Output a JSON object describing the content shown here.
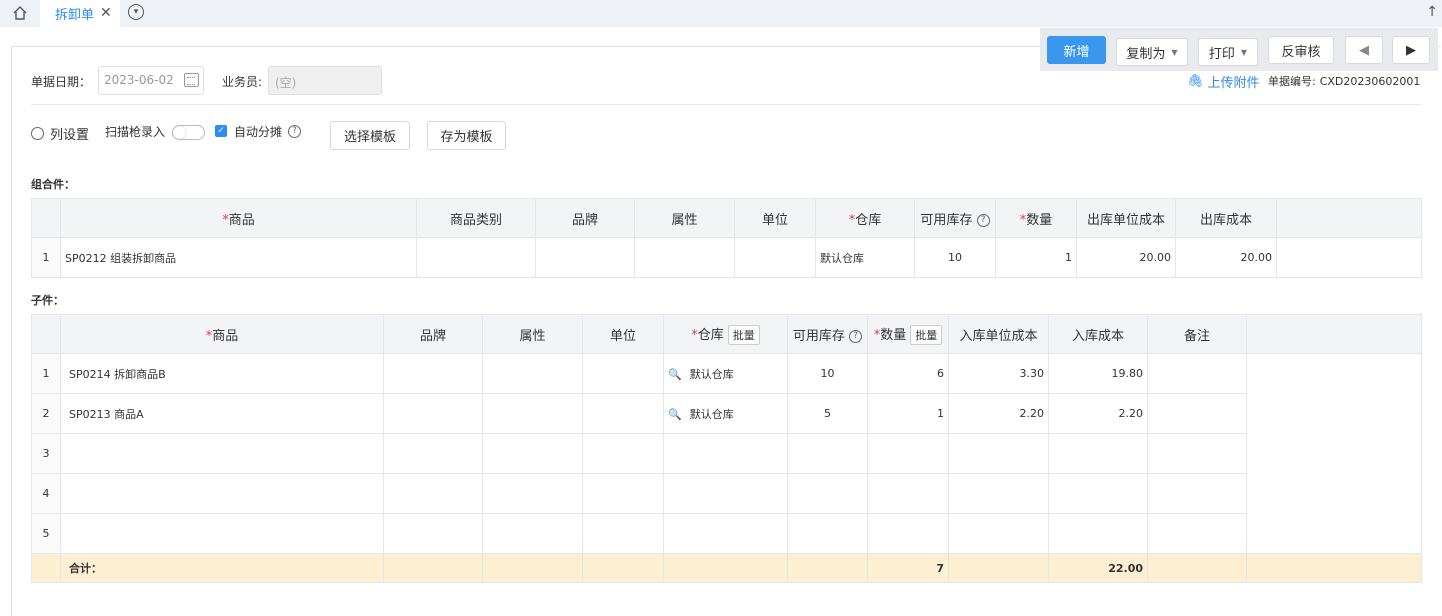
{
  "tabs": {
    "active": "拆卸单"
  },
  "toolbar": {
    "add": "新增",
    "copy_as": "复制为",
    "print": "打印",
    "unaudit": "反审核"
  },
  "header": {
    "date_label": "单据日期：",
    "date_value": "2023-06-02",
    "salesperson_label": "业务员:",
    "salesperson_value": "(空)",
    "upload": "上传附件",
    "doc_no_label": "单据编号:",
    "doc_no": "CXD20230602001"
  },
  "options": {
    "columns": "列设置",
    "scan": "扫描枪录入",
    "auto_alloc": "自动分摊",
    "choose_template": "选择模板",
    "save_template": "存为模板"
  },
  "combo": {
    "title": "组合件：",
    "columns": [
      "商品",
      "商品类别",
      "品牌",
      "属性",
      "单位",
      "仓库",
      "可用库存",
      "数量",
      "出库单位成本",
      "出库成本"
    ],
    "rows": [
      {
        "idx": "1",
        "product": "SP0212 组装拆卸商品",
        "category": "",
        "brand": "",
        "attr": "",
        "unit": "",
        "warehouse": "默认仓库",
        "stock": "10",
        "qty": "1",
        "unit_cost": "20.00",
        "cost": "20.00"
      }
    ]
  },
  "child": {
    "title": "子件：",
    "columns": [
      "商品",
      "品牌",
      "属性",
      "单位",
      "仓库",
      "批量",
      "可用库存",
      "数量",
      "批量",
      "入库单位成本",
      "入库成本",
      "备注"
    ],
    "rows": [
      {
        "idx": "1",
        "product": "SP0214 拆卸商品B",
        "warehouse": "默认仓库",
        "stock": "10",
        "qty": "6",
        "unit_cost": "3.30",
        "cost": "19.80"
      },
      {
        "idx": "2",
        "product": "SP0213 商品A",
        "warehouse": "默认仓库",
        "stock": "5",
        "qty": "1",
        "unit_cost": "2.20",
        "cost": "2.20"
      },
      {
        "idx": "3"
      },
      {
        "idx": "4"
      },
      {
        "idx": "5"
      }
    ],
    "total_label": "合计：",
    "total_qty": "7",
    "total_cost": "22.00"
  }
}
